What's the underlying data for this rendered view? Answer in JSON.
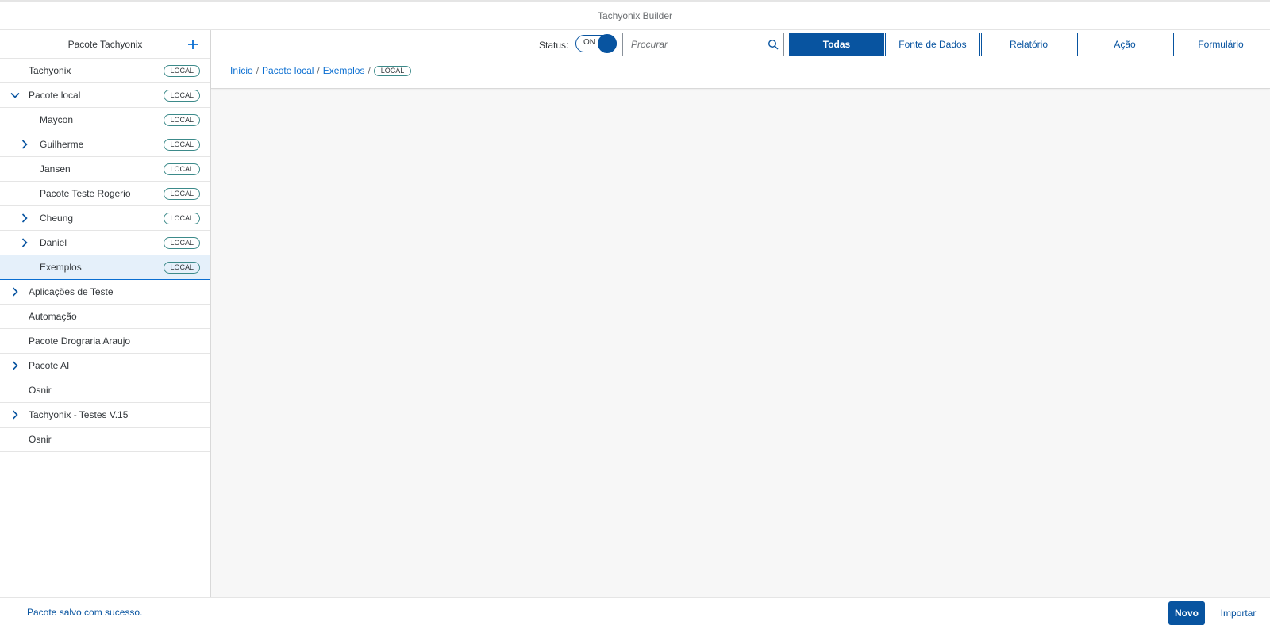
{
  "app": {
    "title": "Tachyonix Builder"
  },
  "sidebar": {
    "title": "Pacote Tachyonix",
    "add_icon": "plus-icon",
    "items": [
      {
        "label": "Tachyonix",
        "badge": "LOCAL",
        "level": 0,
        "arrow": "none"
      },
      {
        "label": "Pacote local",
        "badge": "LOCAL",
        "level": 0,
        "arrow": "down"
      },
      {
        "label": "Maycon",
        "badge": "LOCAL",
        "level": 1,
        "arrow": "none"
      },
      {
        "label": "Guilherme",
        "badge": "LOCAL",
        "level": 1,
        "arrow": "right"
      },
      {
        "label": "Jansen",
        "badge": "LOCAL",
        "level": 1,
        "arrow": "none"
      },
      {
        "label": "Pacote Teste Rogerio",
        "badge": "LOCAL",
        "level": 1,
        "arrow": "none"
      },
      {
        "label": "Cheung",
        "badge": "LOCAL",
        "level": 1,
        "arrow": "right"
      },
      {
        "label": "Daniel",
        "badge": "LOCAL",
        "level": 1,
        "arrow": "right"
      },
      {
        "label": "Exemplos",
        "badge": "LOCAL",
        "level": 1,
        "arrow": "none",
        "selected": true
      },
      {
        "label": "Aplicações de Teste",
        "badge": "",
        "level": 0,
        "arrow": "right"
      },
      {
        "label": "Automação",
        "badge": "",
        "level": 0,
        "arrow": "none"
      },
      {
        "label": "Pacote Drograria Araujo",
        "badge": "",
        "level": 0,
        "arrow": "none"
      },
      {
        "label": "Pacote AI",
        "badge": "",
        "level": 0,
        "arrow": "right"
      },
      {
        "label": "Osnir",
        "badge": "",
        "level": 0,
        "arrow": "none"
      },
      {
        "label": "Tachyonix - Testes V.15",
        "badge": "",
        "level": 0,
        "arrow": "right"
      },
      {
        "label": "Osnir",
        "badge": "",
        "level": 0,
        "arrow": "none"
      }
    ]
  },
  "toolbar": {
    "status_label": "Status:",
    "toggle_text": "ON",
    "search_placeholder": "Procurar",
    "search_icon": "search-icon",
    "filters": [
      {
        "label": "Todas",
        "active": true
      },
      {
        "label": "Fonte de Dados",
        "active": false
      },
      {
        "label": "Relatório",
        "active": false
      },
      {
        "label": "Ação",
        "active": false
      },
      {
        "label": "Formulário",
        "active": false
      }
    ]
  },
  "breadcrumb": {
    "items": [
      "Início",
      "Pacote local",
      "Exemplos"
    ],
    "badge": "LOCAL"
  },
  "footer": {
    "message": "Pacote salvo com sucesso.",
    "novo_label": "Novo",
    "importar_label": "Importar"
  },
  "colors": {
    "accent": "#0854a0",
    "link": "#0a6ed1",
    "selected_bg": "#e5f0fa",
    "content_bg": "#f7f7f7"
  }
}
